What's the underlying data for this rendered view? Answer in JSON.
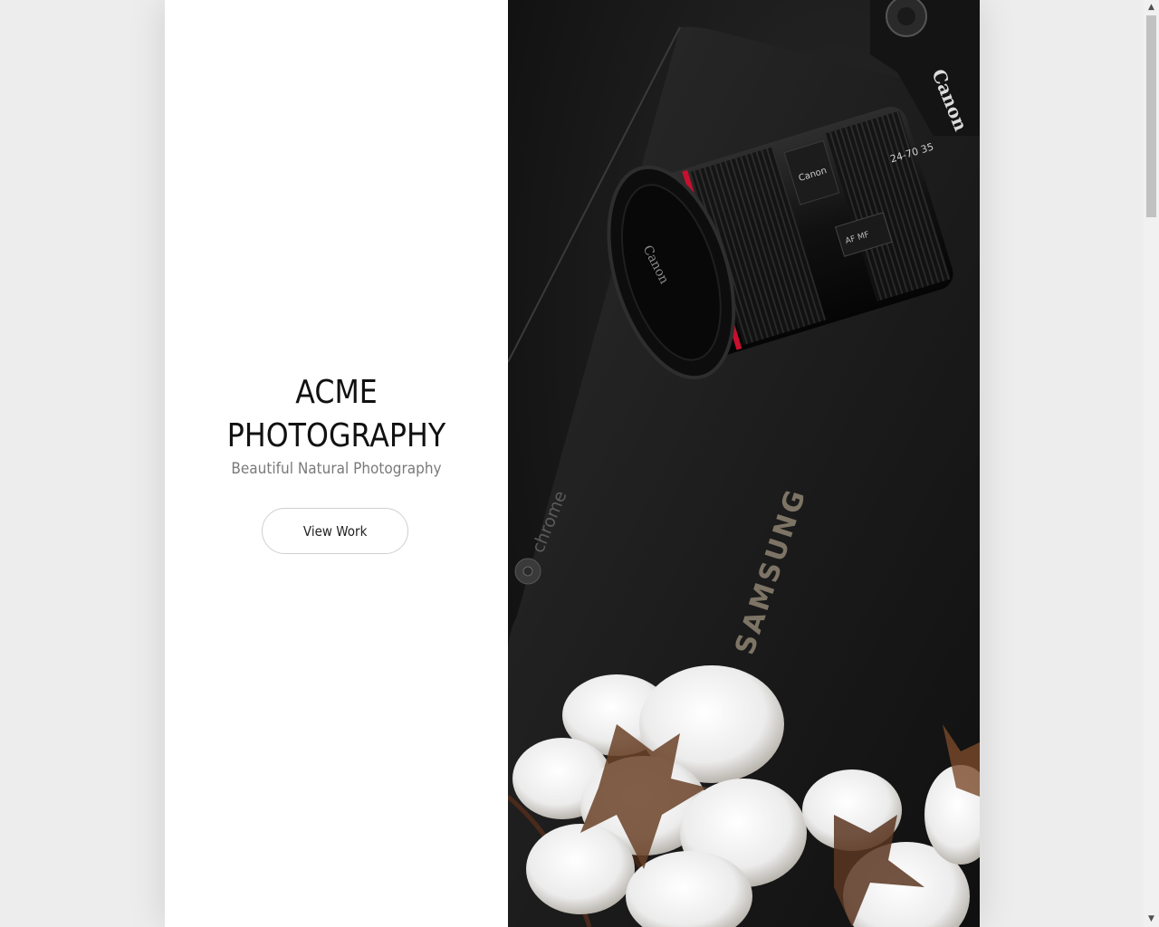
{
  "hero": {
    "title_line1": "ACME",
    "title_line2": "PHOTOGRAPHY",
    "tagline": "Beautiful Natural Photography",
    "cta_label": "View Work"
  },
  "photo": {
    "camera_brand": "Canon",
    "lens_marking": "24-70 35",
    "laptop_brand": "SAMSUNG",
    "laptop_os": "chrome",
    "af_switch": "AF MF"
  },
  "colors": {
    "page_bg": "#ededed",
    "panel_bg": "#ffffff",
    "title": "#111111",
    "tagline": "#7a7a7a",
    "lens_ring": "#c8102e"
  },
  "scrollbar": {
    "up_icon": "scroll-up-arrow-icon",
    "down_icon": "scroll-down-arrow-icon"
  }
}
